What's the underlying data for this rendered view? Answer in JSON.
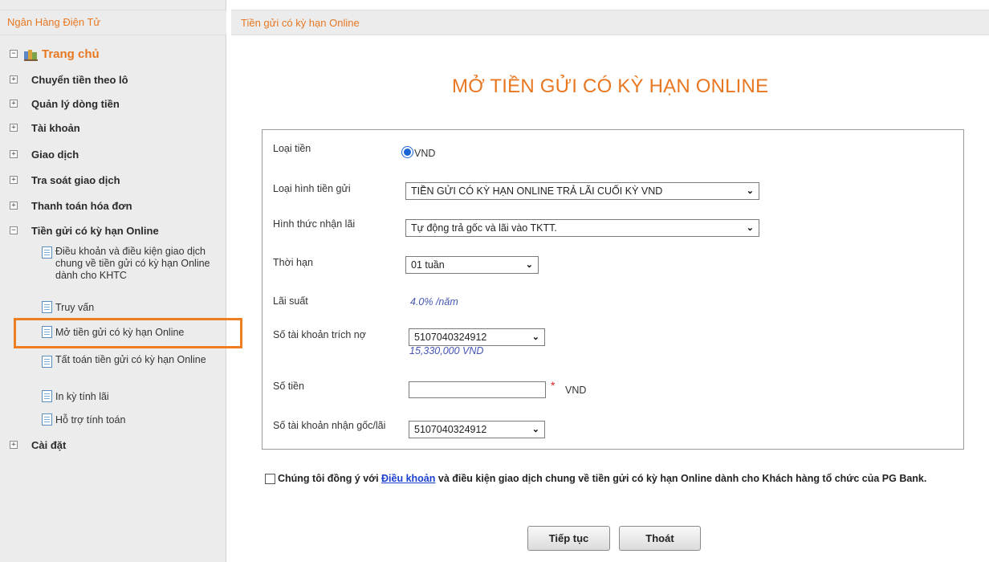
{
  "sidebar": {
    "title": "Ngân Hàng Điện Tử",
    "home": "Trang chủ",
    "items": [
      {
        "label": "Chuyển tiền theo lô",
        "toggle": "+"
      },
      {
        "label": "Quản lý dòng tiền",
        "toggle": "+"
      },
      {
        "label": "Tài khoản",
        "toggle": "+"
      },
      {
        "label": "Giao dịch",
        "toggle": "+"
      },
      {
        "label": "Tra soát giao dịch",
        "toggle": "+"
      },
      {
        "label": "Thanh toán hóa đơn",
        "toggle": "+"
      },
      {
        "label": "Tiền gửi có kỳ hạn Online",
        "toggle": "−"
      },
      {
        "label": "Cài đặt",
        "toggle": "+"
      }
    ],
    "subitems": [
      {
        "label": "Điều khoản và điều kiện giao dịch chung về tiền gửi có kỳ hạn Online dành cho KHTC"
      },
      {
        "label": "Truy vấn"
      },
      {
        "label": "Mở tiền gửi có kỳ hạn Online"
      },
      {
        "label": "Tất toán tiền gửi có kỳ hạn Online"
      },
      {
        "label": "In kỳ tính lãi"
      },
      {
        "label": "Hỗ trợ tính toán"
      }
    ]
  },
  "main": {
    "breadcrumb": "Tiền gửi có kỳ hạn Online",
    "title": "MỞ TIỀN GỬI CÓ KỲ HẠN ONLINE"
  },
  "form": {
    "currency_label": "Loại tiền",
    "currency_value": "VND",
    "deposit_type_label": "Loại hình tiền gửi",
    "deposit_type_value": "TIỀN GỬI CÓ KỲ HẠN ONLINE TRẢ LÃI CUỐI KỲ VND",
    "interest_method_label": "Hình thức nhận lãi",
    "interest_method_value": "Tự động trả gốc và lãi vào TKTT.",
    "term_label": "Thời hạn",
    "term_value": "01 tuần",
    "rate_label": "Lãi suất",
    "rate_value": "4.0% /năm",
    "debit_account_label": "Số tài khoản trích nợ",
    "debit_account_value": "5107040324912",
    "debit_balance": "15,330,000 VND",
    "amount_label": "Số tiền",
    "amount_value": "",
    "required_mark": "*",
    "amount_unit": "VND",
    "receive_account_label": "Số tài khoản nhận gốc/lãi",
    "receive_account_value": "5107040324912"
  },
  "agreement": {
    "prefix": "Chúng tôi đồng ý với ",
    "link": "Điều khoản",
    "suffix": " và điều kiện giao dịch chung về tiền gửi có kỳ hạn Online dành cho Khách hàng tổ chức của PG Bank."
  },
  "buttons": {
    "continue": "Tiếp tục",
    "exit": "Thoát"
  },
  "colors": {
    "accent_orange": "#e87722",
    "highlight_box": "#ef7d22",
    "link_blue": "#1a3fcc",
    "radio_blue": "#1a64d6"
  }
}
